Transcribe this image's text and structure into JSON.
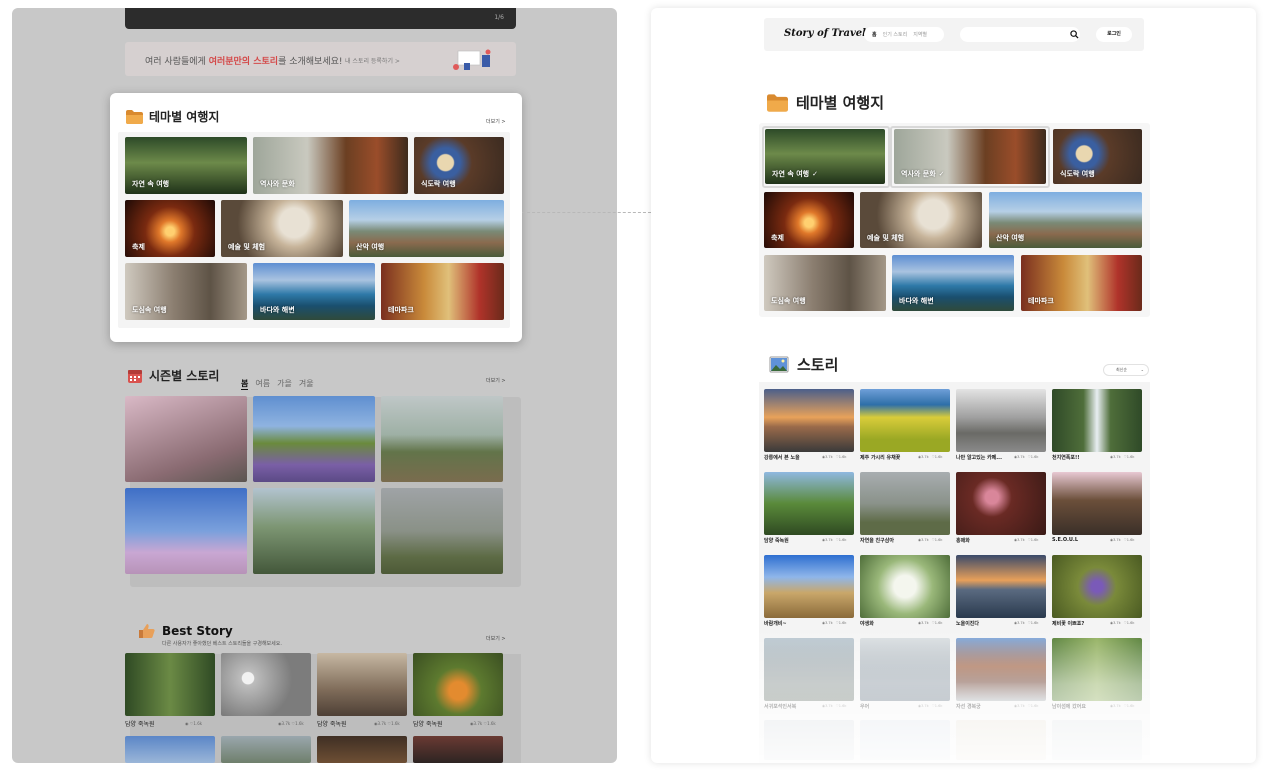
{
  "left": {
    "top_page_indicator": "1/6",
    "banner": {
      "text_before": "여러 사람들에게 ",
      "text_highlight": "여러분만의 스토리",
      "text_after": "를 소개해보세요!",
      "link": "내 스토리 등록하기 >"
    },
    "theme": {
      "title": "테마별 여행지",
      "more": "더보기 >",
      "items": [
        "자연 속 여행",
        "역사와 문화",
        "식도락 여행",
        "축제",
        "예술 및 체험",
        "산악 여행",
        "도심속 여행",
        "바다와 해변",
        "테마파크"
      ]
    },
    "season": {
      "title": "시즌별 스토리",
      "tabs": [
        "봄",
        "여름",
        "가을",
        "겨울"
      ],
      "more": "더보기 >"
    },
    "best": {
      "title": "Best Story",
      "subtitle": "다른 사용자가 좋아했던 베스트 스토리들을 구경해보세요.",
      "more": "더보기 >",
      "items": [
        {
          "title": "담양 죽녹원",
          "views": "",
          "likes": "1.6k"
        },
        {
          "title": "",
          "views": "3.7k",
          "likes": "1.6k"
        },
        {
          "title": "담양 죽녹원",
          "views": "3.7k",
          "likes": "1.6k"
        },
        {
          "title": "담양 죽녹원",
          "views": "3.7k",
          "likes": "1.6k"
        }
      ]
    }
  },
  "right": {
    "header": {
      "logo": "Story of Travel",
      "nav": [
        "홈",
        "인기 스토리",
        "지역별"
      ],
      "search_placeholder": "",
      "login": "로그인"
    },
    "theme": {
      "title": "테마별 여행지",
      "items": [
        {
          "label": "자연 속 여행",
          "selected": true
        },
        {
          "label": "역사와 문화",
          "selected": true
        },
        {
          "label": "식도락 여행",
          "selected": false
        },
        {
          "label": "축제",
          "selected": false
        },
        {
          "label": "예술 및 체험",
          "selected": false
        },
        {
          "label": "산악 여행",
          "selected": false
        },
        {
          "label": "도심속 여행",
          "selected": false
        },
        {
          "label": "바다와 해변",
          "selected": false
        },
        {
          "label": "테마파크",
          "selected": false
        }
      ],
      "check_glyph": "✓"
    },
    "story": {
      "title": "스토리",
      "sort": "최신순",
      "items": [
        {
          "title": "강릉에서 본 노을",
          "views": "3.7k",
          "likes": "1.6k"
        },
        {
          "title": "제주 가시리 유채꽃",
          "views": "3.7k",
          "likes": "1.6k"
        },
        {
          "title": "나만 알고있는 카페...",
          "views": "3.7k",
          "likes": "1.6k"
        },
        {
          "title": "천지연폭포!!",
          "views": "3.7k",
          "likes": "1.6k"
        },
        {
          "title": "담양 죽녹원",
          "views": "3.7k",
          "likes": "1.6k"
        },
        {
          "title": "자연을 친구삼아",
          "views": "3.7k",
          "likes": "1.6k"
        },
        {
          "title": "홍매화",
          "views": "3.7k",
          "likes": "1.6k"
        },
        {
          "title": "S.E.O.U.L",
          "views": "3.7k",
          "likes": "1.6k"
        },
        {
          "title": "바람개비~",
          "views": "3.7k",
          "likes": "1.6k"
        },
        {
          "title": "야생화",
          "views": "3.7k",
          "likes": "1.6k"
        },
        {
          "title": "노을이진다",
          "views": "3.7k",
          "likes": "1.6k"
        },
        {
          "title": "제비꽃 이쁘죠?",
          "views": "3.7k",
          "likes": "1.6k"
        },
        {
          "title": "서귀포석인서복",
          "views": "3.7k",
          "likes": "1.6k"
        },
        {
          "title": "우어",
          "views": "3.7k",
          "likes": "1.6k"
        },
        {
          "title": "자선 경복궁",
          "views": "3.7k",
          "likes": "1.6k"
        },
        {
          "title": "남이섬에 갔어요",
          "views": "3.7k",
          "likes": "1.6k"
        }
      ]
    }
  },
  "icons": {
    "eye": "◉",
    "heart": "♡"
  }
}
